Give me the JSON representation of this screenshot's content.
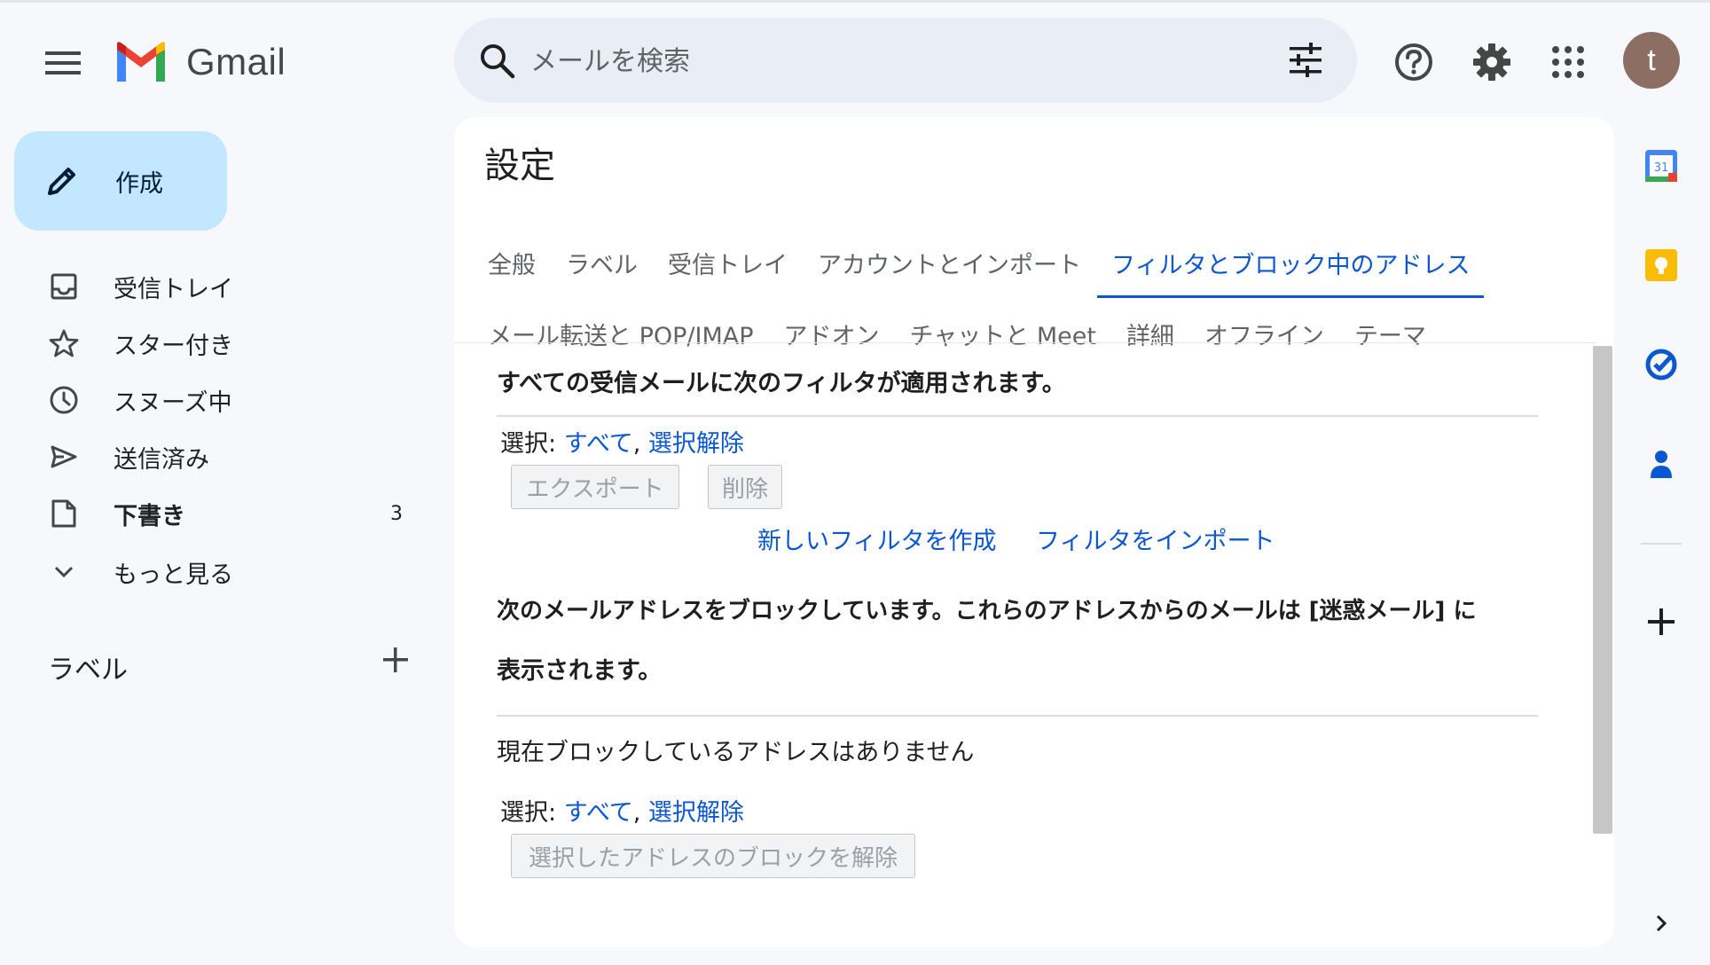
{
  "app": {
    "name": "Gmail"
  },
  "search": {
    "placeholder": "メールを検索"
  },
  "user": {
    "initial": "t"
  },
  "compose": {
    "label": "作成"
  },
  "sidebar": {
    "items": [
      {
        "label": "受信トレイ",
        "icon": "inbox-icon"
      },
      {
        "label": "スター付き",
        "icon": "star-icon"
      },
      {
        "label": "スヌーズ中",
        "icon": "clock-icon"
      },
      {
        "label": "送信済み",
        "icon": "send-icon"
      },
      {
        "label": "下書き",
        "icon": "draft-icon",
        "count": "3"
      },
      {
        "label": "もっと見る",
        "icon": "chevron-down-icon"
      }
    ],
    "labels_header": "ラベル"
  },
  "settings": {
    "title": "設定",
    "tabs_row1": [
      "全般",
      "ラベル",
      "受信トレイ",
      "アカウントとインポート",
      "フィルタとブロック中のアドレス"
    ],
    "tabs_row2": [
      "メール転送と POP/IMAP",
      "アドオン",
      "チャットと Meet",
      "詳細",
      "オフライン",
      "テーマ"
    ],
    "active_tab": "フィルタとブロック中のアドレス",
    "filters_heading": "すべての受信メールに次のフィルタが適用されます。",
    "select_label": "選択:",
    "select_all": "すべて",
    "select_none": "選択解除",
    "export_button": "エクスポート",
    "delete_button": "削除",
    "create_filter": "新しいフィルタを作成",
    "import_filters": "フィルタをインポート",
    "blocked_heading_line1": "次のメールアドレスをブロックしています。これらのアドレスからのメールは [迷惑メール] に",
    "blocked_heading_line2": "表示されます。",
    "no_blocked": "現在ブロックしているアドレスはありません",
    "unblock_button": "選択したアドレスのブロックを解除"
  },
  "colors": {
    "accent": "#0b57d0",
    "compose_bg": "#c2e7ff",
    "avatar_bg": "#8d6e63"
  }
}
